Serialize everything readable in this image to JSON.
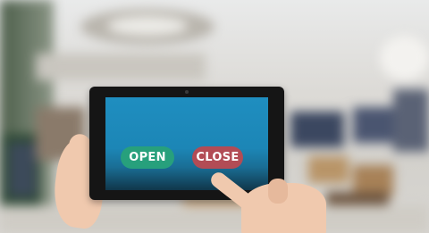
{
  "scene": {
    "description_tags": [
      "blurred-retail-store-background",
      "hands-holding-tablet",
      "finger-pressing-button"
    ],
    "colors": {
      "open_button": "#27a07c",
      "close_button": "#b24c55",
      "screen": "#1f8ec0",
      "tablet_bezel": "#151515",
      "skin": "#f0c9ae"
    }
  },
  "tablet_screen": {
    "open_label": "OPEN",
    "close_label": "CLOSE"
  }
}
